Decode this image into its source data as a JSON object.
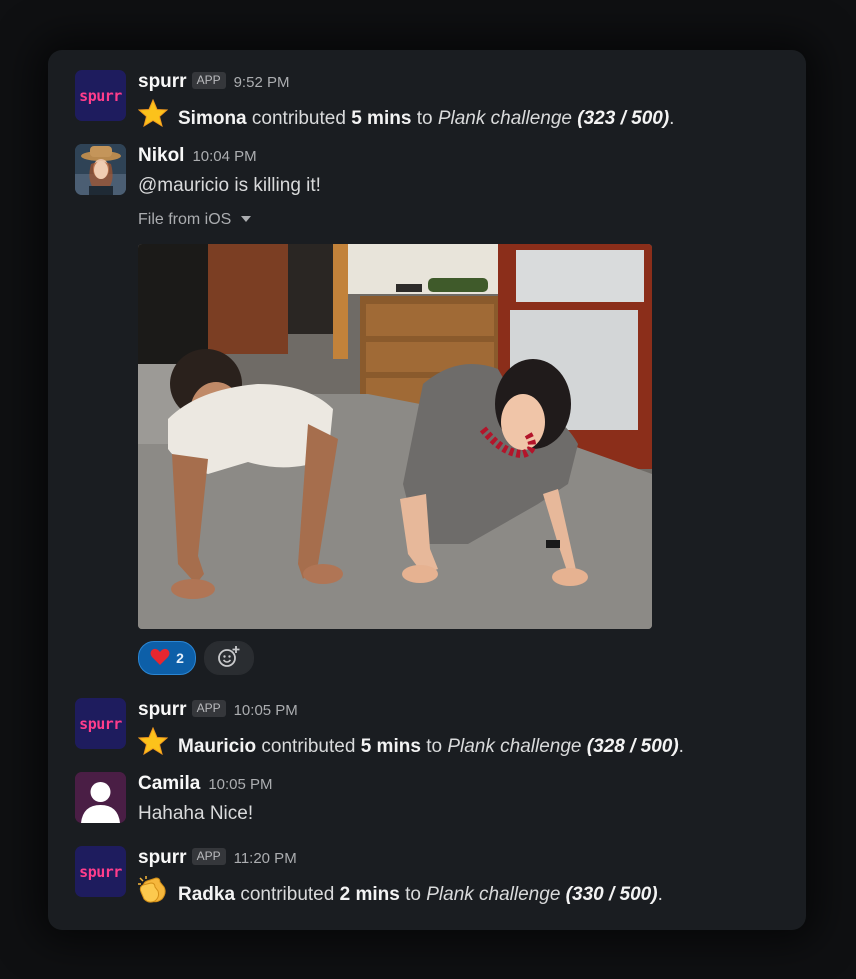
{
  "messages": [
    {
      "sender": "spurr",
      "badge": "APP",
      "time": "9:52 PM",
      "icon": "star",
      "person": "Simona",
      "verb": "contributed",
      "amount": "5 mins",
      "prep": "to",
      "challenge": "Plank challenge",
      "progress": "(323 / 500)",
      "end": "."
    },
    {
      "sender": "Nikol",
      "time": "10:04 PM",
      "text": "@mauricio is killing it!",
      "file_label": "File from iOS",
      "photo_alt": "Two people doing a plank on a carpeted floor",
      "reaction": {
        "emoji": "❤️",
        "count": "2"
      }
    },
    {
      "sender": "spurr",
      "badge": "APP",
      "time": "10:05 PM",
      "icon": "star",
      "person": "Mauricio",
      "verb": "contributed",
      "amount": "5 mins",
      "prep": "to",
      "challenge": "Plank challenge",
      "progress": "(328 / 500)",
      "end": "."
    },
    {
      "sender": "Camila",
      "time": "10:05 PM",
      "text": "Hahaha Nice!"
    },
    {
      "sender": "spurr",
      "badge": "APP",
      "time": "11:20 PM",
      "icon": "clapping-hands",
      "person": "Radka",
      "verb": "contributed",
      "amount": "2 mins",
      "prep": "to",
      "challenge": "Plank challenge",
      "progress": "(330 / 500)",
      "end": "."
    }
  ],
  "spurr_logo": "spurr",
  "colors": {
    "background": "#1a1d21",
    "spurr_avatar": "#1e1c5e",
    "spurr_logo": "#ff3d8b",
    "reaction_active": "#0d5fa8"
  }
}
